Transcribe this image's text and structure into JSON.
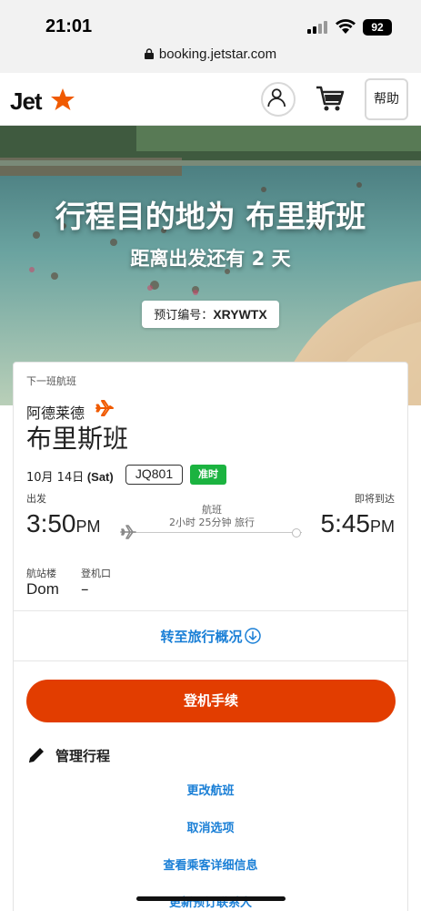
{
  "status_bar": {
    "time": "21:01",
    "battery": "92"
  },
  "url_bar": {
    "domain": "booking.jetstar.com"
  },
  "header": {
    "logo": "Jet",
    "help_label": "帮助"
  },
  "hero": {
    "title": "行程目的地为 布里斯班",
    "countdown": "距离出发还有 2 天",
    "booking_ref_label": "预订编号：",
    "booking_ref_value": "XRYWTX"
  },
  "flight": {
    "section_label": "下一班航班",
    "origin": "阿德莱德",
    "destination": "布里斯班",
    "date": "10月 14日",
    "weekday": " (Sat)",
    "flight_number": "JQ801",
    "status": "准时",
    "depart_label": "出发",
    "arrive_label": "即将到达",
    "depart_time": "3:50",
    "depart_ampm": "PM",
    "arrive_time": "5:45",
    "arrive_ampm": "PM",
    "route_type": "航班",
    "duration": "2小时 25分钟 旅行",
    "terminal_label": "航站楼",
    "terminal_value": "Dom",
    "gate_label": "登机口",
    "gate_value": "–"
  },
  "actions": {
    "overview_link": "转至旅行概况",
    "checkin_button": "登机手续",
    "manage_title": "管理行程",
    "links": [
      "更改航班",
      "取消选项",
      "查看乘客详细信息",
      "更新预订联系人"
    ]
  },
  "colors": {
    "brand_orange": "#e23d00",
    "link_blue": "#1a7fd6",
    "ontime_green": "#1bb340"
  }
}
